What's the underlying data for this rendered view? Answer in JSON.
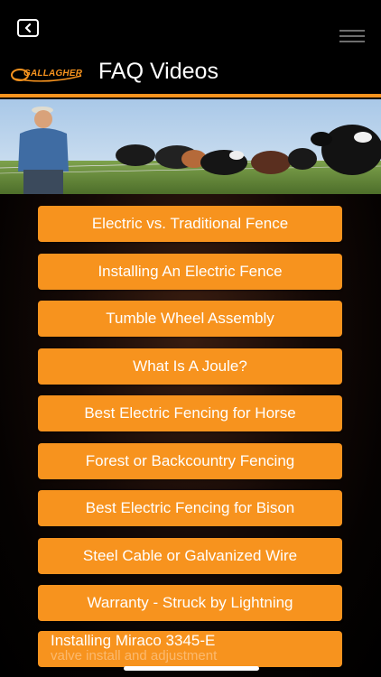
{
  "header": {
    "title": "FAQ Videos",
    "logo_text": "GALLAGHER",
    "accent_color": "#f7931e"
  },
  "nav": {
    "back_icon": "chevron-left-icon",
    "menu_icon": "hamburger-menu-icon"
  },
  "faq": {
    "items": [
      {
        "label": "Electric vs. Traditional Fence"
      },
      {
        "label": "Installing An Electric Fence"
      },
      {
        "label": "Tumble Wheel Assembly"
      },
      {
        "label": "What Is A Joule?"
      },
      {
        "label": "Best Electric Fencing for Horse"
      },
      {
        "label": "Forest or Backcountry Fencing"
      },
      {
        "label": "Best Electric Fencing for Bison"
      },
      {
        "label": "Steel Cable or Galvanized Wire"
      },
      {
        "label": "Warranty - Struck by Lightning"
      },
      {
        "label": "Installing Miraco 3345-E",
        "sublabel": "valve install and adjustment"
      }
    ]
  }
}
